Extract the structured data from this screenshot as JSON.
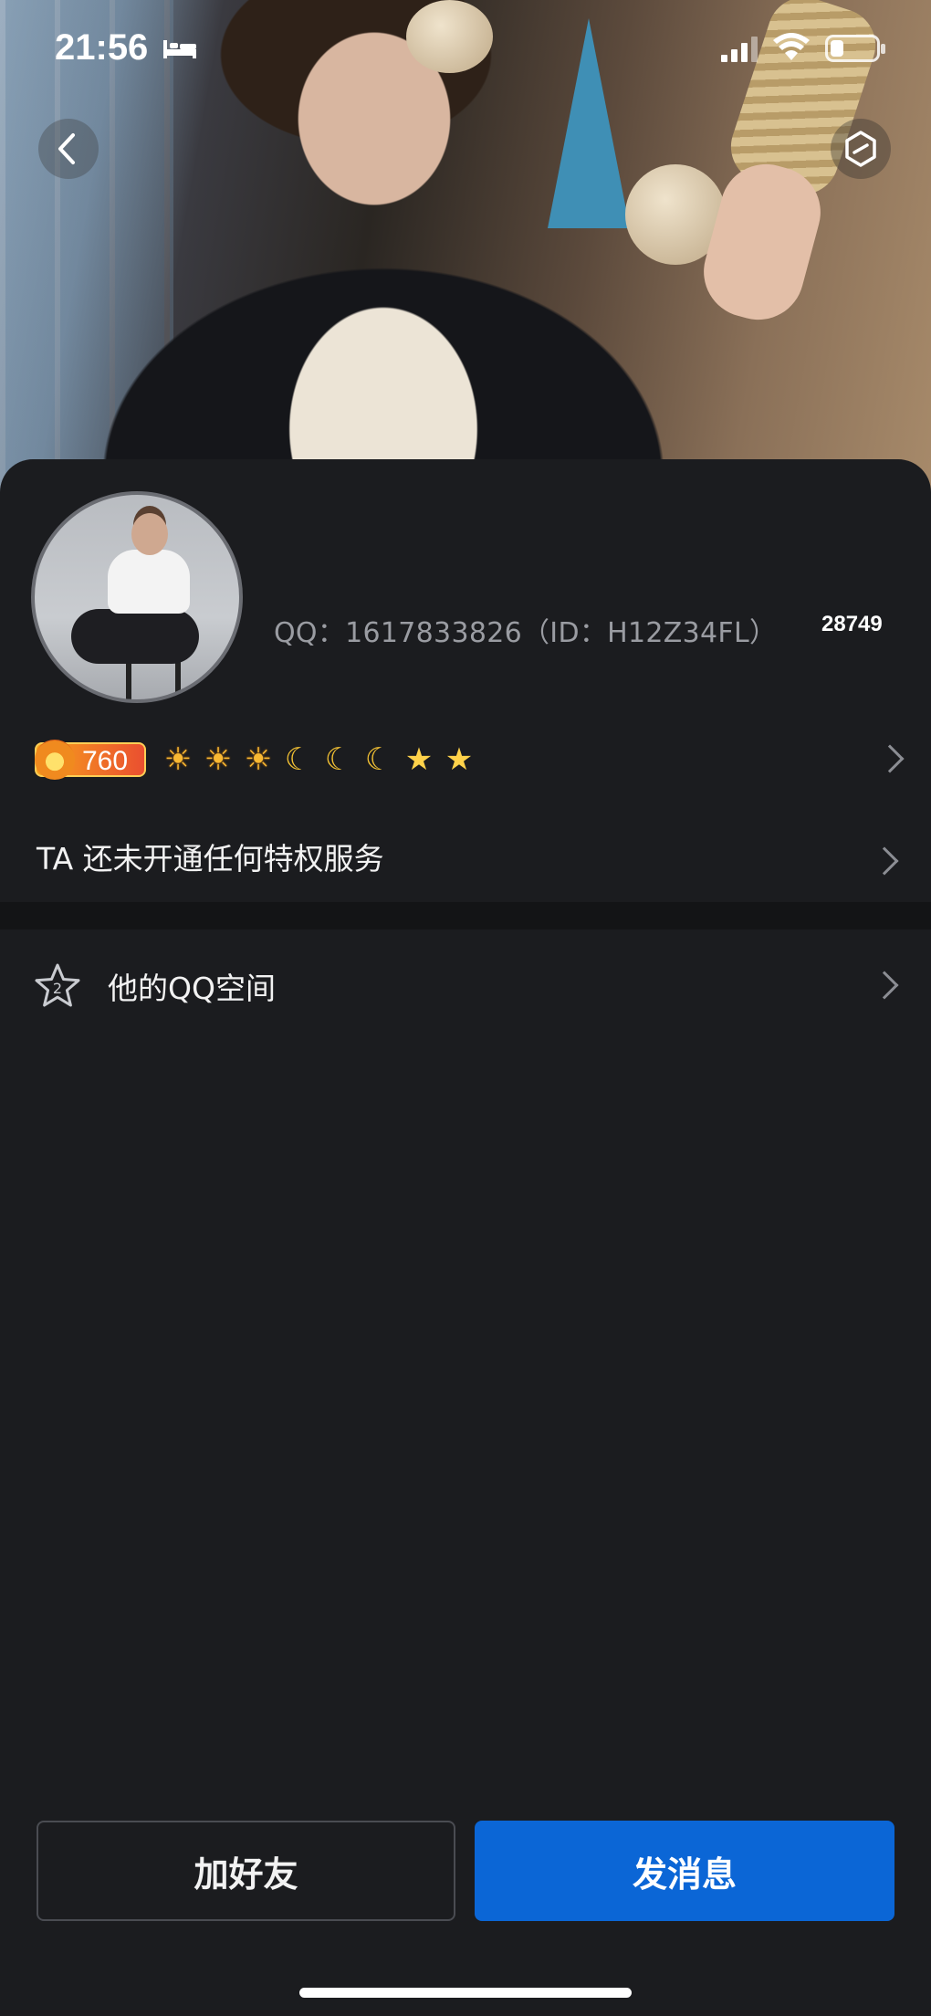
{
  "status_bar": {
    "time": "21:56",
    "icons": [
      "bed-icon",
      "signal-icon",
      "wifi-icon",
      "battery-icon"
    ]
  },
  "header": {
    "back_icon": "chevron-left-icon",
    "share_icon": "hexagon-share-icon"
  },
  "profile": {
    "qq_line": "QQ：1617833826（ID：H12Z34FL）",
    "like_count": "28749",
    "level": "760",
    "grade_icons": [
      "sun",
      "sun",
      "sun",
      "moon",
      "moon",
      "moon",
      "star",
      "star"
    ]
  },
  "privilege": {
    "text": "TA 还未开通任何特权服务"
  },
  "zone": {
    "label": "他的QQ空间",
    "icon": "star-icon",
    "badge": "2"
  },
  "actions": {
    "add_friend": "加好友",
    "send_message": "发消息"
  },
  "colors": {
    "background": "#1b1c1f",
    "primary_button": "#0b66d6",
    "muted_text": "#9a9ca2"
  }
}
